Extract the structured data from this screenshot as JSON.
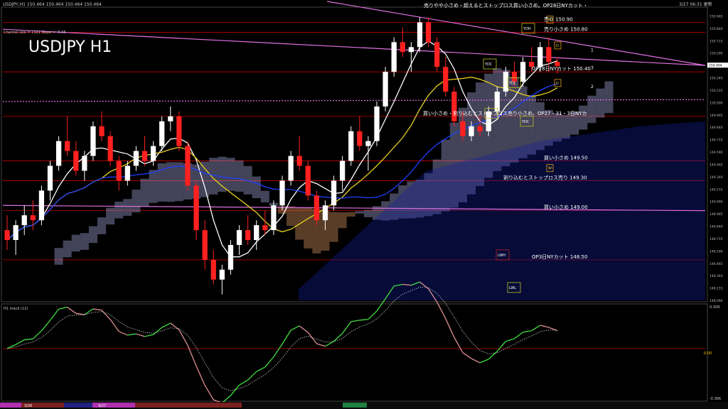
{
  "window": {
    "symbol_info": "USDJPY,H1  150.464 150.464 150.464 150.464",
    "timestamp": "3/27 06:31 更新",
    "watermark": "USDJPY H1",
    "channel_info": "Channel size = 1321 Slope = -5.05",
    "indicator_label": "H1  macd (12)"
  },
  "colors": {
    "background": "#000000",
    "bull_candle": "#ffffff",
    "bear_candle": "#ff2020",
    "sma_fast": "#ffffff",
    "sma_mid": "#e8d020",
    "sma_slow": "#2040ff",
    "channel": "#e070e0",
    "level_line": "#c00000",
    "macd_up": "#40e040",
    "macd_down": "#e09090",
    "cloud_bull": "#c0c0ff",
    "cloud_bear": "#ffb070"
  },
  "chart_data": {
    "type": "candlestick",
    "price_axis": {
      "ylim": [
        148.09,
        151.04
      ],
      "ticks": [
        "150.965",
        "150.840",
        "150.715",
        "150.590",
        "150.464",
        "150.340",
        "150.215",
        "150.090",
        "149.965",
        "149.840",
        "149.715",
        "149.590",
        "149.465",
        "149.340",
        "149.215",
        "149.090",
        "148.965",
        "148.840",
        "148.715",
        "148.590",
        "148.465",
        "148.340",
        "148.215",
        "148.090"
      ],
      "current": "150.464"
    },
    "time_axis": {
      "labels": [
        "3/26",
        "3/27"
      ]
    },
    "ohlc": [
      [
        148.8,
        148.95,
        148.6,
        148.7
      ],
      [
        148.7,
        148.9,
        148.55,
        148.85
      ],
      [
        148.85,
        149.05,
        148.75,
        148.95
      ],
      [
        148.95,
        149.1,
        148.8,
        148.9
      ],
      [
        148.9,
        149.25,
        148.85,
        149.2
      ],
      [
        149.2,
        149.5,
        149.1,
        149.45
      ],
      [
        149.45,
        149.75,
        149.4,
        149.7
      ],
      [
        149.7,
        149.95,
        149.55,
        149.6
      ],
      [
        149.6,
        149.7,
        149.35,
        149.4
      ],
      [
        149.4,
        149.6,
        149.3,
        149.55
      ],
      [
        149.55,
        149.9,
        149.5,
        149.85
      ],
      [
        149.85,
        150.0,
        149.7,
        149.75
      ],
      [
        149.75,
        149.8,
        149.45,
        149.5
      ],
      [
        149.5,
        149.55,
        149.2,
        149.3
      ],
      [
        149.3,
        149.5,
        149.25,
        149.45
      ],
      [
        149.45,
        149.65,
        149.4,
        149.6
      ],
      [
        149.6,
        149.75,
        149.45,
        149.5
      ],
      [
        149.5,
        149.7,
        149.45,
        149.65
      ],
      [
        149.65,
        149.95,
        149.6,
        149.9
      ],
      [
        149.9,
        150.05,
        149.8,
        149.95
      ],
      [
        149.95,
        150.0,
        149.6,
        149.65
      ],
      [
        149.65,
        149.7,
        149.2,
        149.25
      ],
      [
        149.25,
        149.3,
        148.7,
        148.8
      ],
      [
        148.8,
        148.9,
        148.4,
        148.5
      ],
      [
        148.5,
        148.6,
        148.25,
        148.3
      ],
      [
        148.3,
        148.45,
        148.15,
        148.4
      ],
      [
        148.4,
        148.7,
        148.35,
        148.65
      ],
      [
        148.65,
        148.85,
        148.55,
        148.8
      ],
      [
        148.8,
        148.95,
        148.65,
        148.7
      ],
      [
        148.7,
        148.9,
        148.6,
        148.85
      ],
      [
        148.85,
        149.0,
        148.75,
        148.8
      ],
      [
        148.8,
        149.1,
        148.75,
        149.05
      ],
      [
        149.05,
        149.35,
        149.0,
        149.3
      ],
      [
        149.3,
        149.6,
        149.25,
        149.55
      ],
      [
        149.55,
        149.75,
        149.4,
        149.45
      ],
      [
        149.45,
        149.5,
        149.1,
        149.15
      ],
      [
        149.15,
        149.2,
        148.85,
        148.9
      ],
      [
        148.9,
        149.1,
        148.8,
        149.05
      ],
      [
        149.05,
        149.35,
        149.0,
        149.3
      ],
      [
        149.3,
        149.55,
        149.2,
        149.5
      ],
      [
        149.5,
        149.85,
        149.45,
        149.8
      ],
      [
        149.8,
        149.95,
        149.6,
        149.65
      ],
      [
        149.65,
        149.75,
        149.4,
        149.7
      ],
      [
        149.7,
        150.1,
        149.65,
        150.05
      ],
      [
        150.05,
        150.45,
        150.0,
        150.4
      ],
      [
        150.4,
        150.75,
        150.35,
        150.7
      ],
      [
        150.7,
        150.85,
        150.55,
        150.6
      ],
      [
        150.6,
        150.7,
        150.4,
        150.65
      ],
      [
        150.65,
        150.95,
        150.6,
        150.9
      ],
      [
        150.9,
        150.95,
        150.65,
        150.7
      ],
      [
        150.7,
        150.75,
        150.4,
        150.45
      ],
      [
        150.45,
        150.55,
        150.15,
        150.2
      ],
      [
        150.2,
        150.25,
        149.85,
        149.9
      ],
      [
        149.9,
        150.0,
        149.7,
        149.75
      ],
      [
        149.75,
        149.9,
        149.7,
        149.85
      ],
      [
        149.85,
        149.95,
        149.75,
        149.8
      ],
      [
        149.8,
        150.05,
        149.75,
        150.0
      ],
      [
        150.0,
        150.25,
        149.95,
        150.2
      ],
      [
        150.2,
        150.45,
        150.15,
        150.4
      ],
      [
        150.4,
        150.5,
        150.25,
        150.3
      ],
      [
        150.3,
        150.55,
        150.25,
        150.5
      ],
      [
        150.5,
        150.65,
        150.4,
        150.45
      ],
      [
        150.45,
        150.7,
        150.4,
        150.65
      ],
      [
        150.65,
        150.75,
        150.4,
        150.5
      ],
      [
        150.5,
        150.55,
        150.38,
        150.46
      ]
    ],
    "moving_averages": [
      {
        "name": "fast",
        "period": 5
      },
      {
        "name": "mid",
        "period": 12
      },
      {
        "name": "slow",
        "period": 24
      }
    ],
    "channel_line_left_price": [
      150.4,
      150.1,
      149.05
    ],
    "channel_line_right_price": [
      150.465,
      150.12,
      149.14
    ],
    "levels": [
      {
        "price": 150.9,
        "label": "売り 150.90"
      },
      {
        "price": 150.8,
        "label": "売り小さめ 150.80"
      },
      {
        "price": 150.4,
        "label": "OP28日NYカット 150.40"
      },
      {
        "price": 149.95,
        "label": "買い小さめ・割り込むとストップロス売り小さめ。OP27・31・3日NYカ"
      },
      {
        "price": 149.5,
        "label": "買い小さめ 149.50"
      },
      {
        "price": 149.3,
        "label": "割り込むとストップロス売り 149.30"
      },
      {
        "price": 149.0,
        "label": "買い小さめ 149.00"
      },
      {
        "price": 148.5,
        "label": "OP3日NYカット 148.50"
      }
    ],
    "top_annotation": "売りやや小さめ・超えるとストップロス買い小さめ。OP28日NYカット・",
    "zone_boxes": [
      "YDC",
      "YDH",
      "YDL",
      "LWH",
      "LWL"
    ],
    "proj_letters": [
      "D",
      "D",
      "W",
      "W"
    ],
    "wave_labels": [
      "1",
      "2",
      "3"
    ],
    "macd": {
      "ylim_label_top": "0.309",
      "zero_label": "0.00",
      "ylim_label_bottom": "-0.366",
      "ylim": [
        -0.366,
        0.309
      ]
    }
  }
}
